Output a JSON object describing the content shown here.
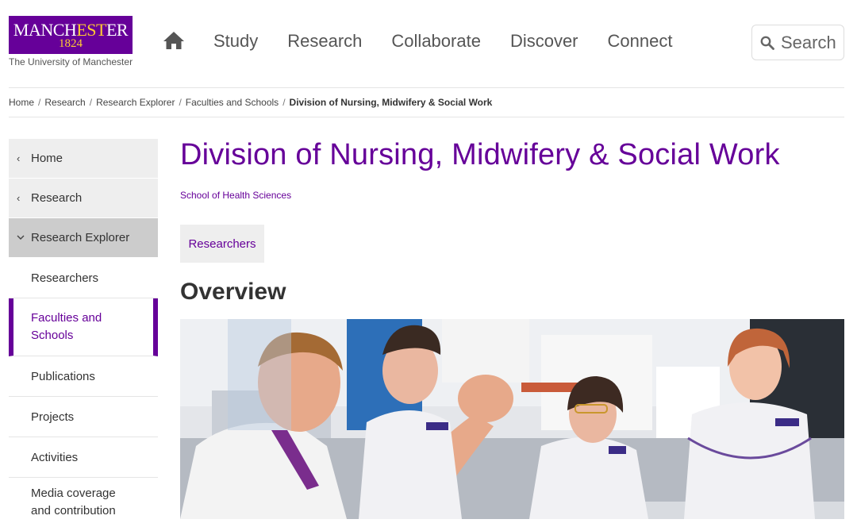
{
  "header": {
    "logo": {
      "wordmark_left": "MANCH",
      "wordmark_mid": "EST",
      "wordmark_right": "ER",
      "year": "1824",
      "subtitle": "The University of Manchester"
    },
    "nav": [
      "Study",
      "Research",
      "Collaborate",
      "Discover",
      "Connect"
    ],
    "search_placeholder": "Search"
  },
  "breadcrumb": [
    "Home",
    "Research",
    "Research Explorer",
    "Faculties and Schools"
  ],
  "breadcrumb_current": "Division of Nursing, Midwifery & Social Work",
  "sidebar": {
    "parents": [
      "Home",
      "Research",
      "Research Explorer"
    ],
    "children": [
      "Researchers",
      "Faculties and Schools",
      "Publications",
      "Projects",
      "Activities",
      "Media coverage and contribution"
    ]
  },
  "main": {
    "title": "Division of Nursing, Midwifery & Social Work",
    "school": "School of Health Sciences",
    "tab": "Researchers",
    "section": "Overview"
  },
  "colors": {
    "brand": "#660099",
    "accent": "#ffcc33"
  }
}
